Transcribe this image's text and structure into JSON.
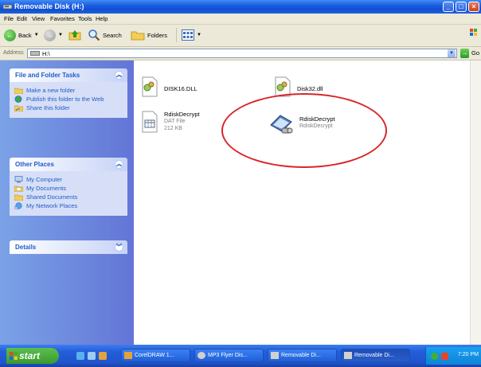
{
  "window": {
    "title": "Removable Disk (H:)"
  },
  "menu": [
    "File",
    "Edit",
    "View",
    "Favorites",
    "Tools",
    "Help"
  ],
  "toolbar": {
    "back": "Back",
    "search": "Search",
    "folders": "Folders"
  },
  "address": {
    "label": "Address",
    "value": "H:\\",
    "go": "Go"
  },
  "left_pane": {
    "file_tasks": {
      "title": "File and Folder Tasks",
      "items": [
        "Make a new folder",
        "Publish this folder to the Web",
        "Share this folder"
      ]
    },
    "other_places": {
      "title": "Other Places",
      "items": [
        "My Computer",
        "My Documents",
        "Shared Documents",
        "My Network Places"
      ]
    },
    "details": {
      "title": "Details"
    }
  },
  "files": [
    {
      "name": "DISK16.DLL",
      "type": "",
      "size": ""
    },
    {
      "name": "Disk32.dll",
      "type": "",
      "size": ""
    },
    {
      "name": "RdiskDecrypt",
      "type": "DAT File",
      "size": "212 KB"
    },
    {
      "name": "RdiskDecrypt",
      "type": "RdiskDecrypt",
      "size": ""
    }
  ],
  "taskbar": {
    "start": "start",
    "tasks": [
      "CorelDRAW 1...",
      "MP3 Flyer Dis...",
      "Removable Di...",
      "Removable Di..."
    ],
    "clock": "7:20 PM"
  },
  "colors": {
    "highlight_ring": "#d8262a",
    "link_blue": "#215dc6",
    "xp_blue": "#245edb"
  }
}
